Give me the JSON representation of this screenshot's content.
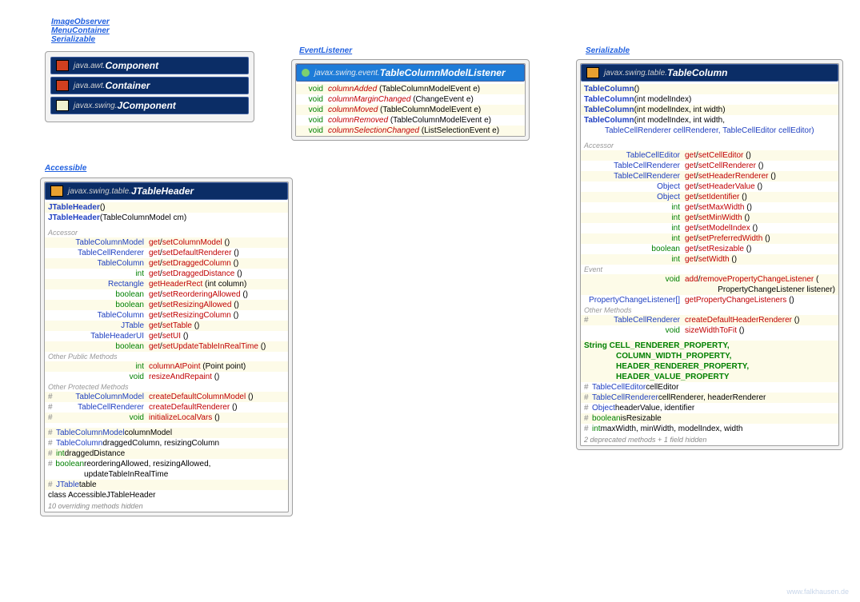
{
  "interfaces_top": [
    "ImageObserver",
    "MenuContainer",
    "Serializable"
  ],
  "interface_eventlistener": "EventListener",
  "interface_accessible": "Accessible",
  "interface_serializable2": "Serializable",
  "component": {
    "pkg": "java.awt.",
    "cls": "Component"
  },
  "container_cls": {
    "pkg": "java.awt.",
    "cls": "Container"
  },
  "jcomponent": {
    "pkg": "javax.swing.",
    "cls": "JComponent"
  },
  "listener": {
    "pkg": "javax.swing.event.",
    "cls": "TableColumnModelListener",
    "methods": [
      {
        "ret": "void",
        "name": "columnAdded",
        "params": "(TableColumnModelEvent e)"
      },
      {
        "ret": "void",
        "name": "columnMarginChanged",
        "params": "(ChangeEvent e)"
      },
      {
        "ret": "void",
        "name": "columnMoved",
        "params": "(TableColumnModelEvent e)"
      },
      {
        "ret": "void",
        "name": "columnRemoved",
        "params": "(TableColumnModelEvent e)"
      },
      {
        "ret": "void",
        "name": "columnSelectionChanged",
        "params": "(ListSelectionEvent e)"
      }
    ]
  },
  "jtableheader": {
    "pkg": "javax.swing.table.",
    "cls": "JTableHeader",
    "ctors": [
      {
        "name": "JTableHeader",
        "params": "()"
      },
      {
        "name": "JTableHeader",
        "params": "(TableColumnModel cm)"
      }
    ],
    "accessor_lbl": "Accessor",
    "accessors": [
      {
        "ret": "TableColumnModel",
        "get": "get",
        "set": "setColumnModel",
        "params": "()"
      },
      {
        "ret": "TableCellRenderer",
        "get": "get",
        "set": "setDefaultRenderer",
        "params": "()"
      },
      {
        "ret": "TableColumn",
        "get": "get",
        "set": "setDraggedColumn",
        "params": "()"
      },
      {
        "ret": "int",
        "get": "get",
        "set": "setDraggedDistance",
        "params": "()"
      },
      {
        "ret": "Rectangle",
        "get": "getHeaderRect",
        "set": "",
        "params": "(int column)"
      },
      {
        "ret": "boolean",
        "get": "get",
        "set": "setReorderingAllowed",
        "params": "()"
      },
      {
        "ret": "boolean",
        "get": "get",
        "set": "setResizingAllowed",
        "params": "()"
      },
      {
        "ret": "TableColumn",
        "get": "get",
        "set": "setResizingColumn",
        "params": "()"
      },
      {
        "ret": "JTable",
        "get": "get",
        "set": "setTable",
        "params": "()"
      },
      {
        "ret": "TableHeaderUI",
        "get": "get",
        "set": "setUI",
        "params": "()"
      },
      {
        "ret": "boolean",
        "get": "get",
        "set": "setUpdateTableInRealTime",
        "params": "()"
      }
    ],
    "pub_lbl": "Other Public Methods",
    "pub": [
      {
        "ret": "int",
        "name": "columnAtPoint",
        "params": "(Point point)"
      },
      {
        "ret": "void",
        "name": "resizeAndRepaint",
        "params": "()"
      }
    ],
    "prot_lbl": "Other Protected Methods",
    "prot": [
      {
        "ret": "TableColumnModel",
        "name": "createDefaultColumnModel",
        "params": "()"
      },
      {
        "ret": "TableCellRenderer",
        "name": "createDefaultRenderer",
        "params": "()"
      },
      {
        "ret": "void",
        "name": "initializeLocalVars",
        "params": "()"
      }
    ],
    "fields": [
      {
        "vis": "#",
        "type": "TableColumnModel",
        "name": "columnModel"
      },
      {
        "vis": "#",
        "type": "TableColumn",
        "name": "draggedColumn, resizingColumn"
      },
      {
        "vis": "#",
        "type": "int",
        "name": "draggedDistance"
      },
      {
        "vis": "#",
        "type": "boolean",
        "name": "reorderingAllowed, resizingAllowed, updateTableInRealTime"
      },
      {
        "vis": "#",
        "type": "JTable",
        "name": "table"
      }
    ],
    "inner": "class AccessibleJTableHeader",
    "footer": "10 overriding methods hidden"
  },
  "tablecolumn": {
    "pkg": "javax.swing.table.",
    "cls": "TableColumn",
    "ctors": [
      {
        "name": "TableColumn",
        "params": "()"
      },
      {
        "name": "TableColumn",
        "params": "(int modelIndex)"
      },
      {
        "name": "TableColumn",
        "params": "(int modelIndex, int width)"
      },
      {
        "name": "TableColumn",
        "params": "(int modelIndex, int width,",
        "params2": "TableCellRenderer cellRenderer, TableCellEditor cellEditor)"
      }
    ],
    "accessor_lbl": "Accessor",
    "accessors": [
      {
        "ret": "TableCellEditor",
        "get": "get",
        "set": "setCellEditor",
        "params": "()"
      },
      {
        "ret": "TableCellRenderer",
        "get": "get",
        "set": "setCellRenderer",
        "params": "()"
      },
      {
        "ret": "TableCellRenderer",
        "get": "get",
        "set": "setHeaderRenderer",
        "params": "()"
      },
      {
        "ret": "Object",
        "get": "get",
        "set": "setHeaderValue",
        "params": "()"
      },
      {
        "ret": "Object",
        "get": "get",
        "set": "setIdentifier",
        "params": "()"
      },
      {
        "ret": "int",
        "get": "get",
        "set": "setMaxWidth",
        "params": "()"
      },
      {
        "ret": "int",
        "get": "get",
        "set": "setMinWidth",
        "params": "()"
      },
      {
        "ret": "int",
        "get": "get",
        "set": "setModelIndex",
        "params": "()"
      },
      {
        "ret": "int",
        "get": "get",
        "set": "setPreferredWidth",
        "params": "()"
      },
      {
        "ret": "boolean",
        "get": "get",
        "set": "setResizable",
        "params": "()"
      },
      {
        "ret": "int",
        "get": "get",
        "set": "setWidth",
        "params": "()"
      }
    ],
    "event_lbl": "Event",
    "event": [
      {
        "ret": "void",
        "name1": "add",
        "name2": "removePropertyChangeListener",
        "params": "(",
        "params2": "PropertyChangeListener listener)"
      },
      {
        "ret": "PropertyChangeListener[]",
        "name1": "getPropertyChangeListeners",
        "name2": "",
        "params": "()"
      }
    ],
    "other_lbl": "Other Methods",
    "other": [
      {
        "vis": "#",
        "ret": "TableCellRenderer",
        "name": "createDefaultHeaderRenderer",
        "params": "()"
      },
      {
        "vis": "",
        "ret": "void",
        "name": "sizeWidthToFit",
        "params": "()"
      }
    ],
    "consts": [
      "String CELL_RENDERER_PROPERTY,",
      "COLUMN_WIDTH_PROPERTY,",
      "HEADER_RENDERER_PROPERTY,",
      "HEADER_VALUE_PROPERTY"
    ],
    "fields": [
      {
        "vis": "#",
        "type": "TableCellEditor",
        "name": "cellEditor"
      },
      {
        "vis": "#",
        "type": "TableCellRenderer",
        "name": "cellRenderer, headerRenderer"
      },
      {
        "vis": "#",
        "type": "Object",
        "name": "headerValue, identifier"
      },
      {
        "vis": "#",
        "type": "boolean",
        "name": "isResizable"
      },
      {
        "vis": "#",
        "type": "int",
        "name": "maxWidth, minWidth, modelIndex, width"
      }
    ],
    "footer": "2 deprecated methods + 1 field hidden"
  },
  "watermark": "www.falkhausen.de"
}
